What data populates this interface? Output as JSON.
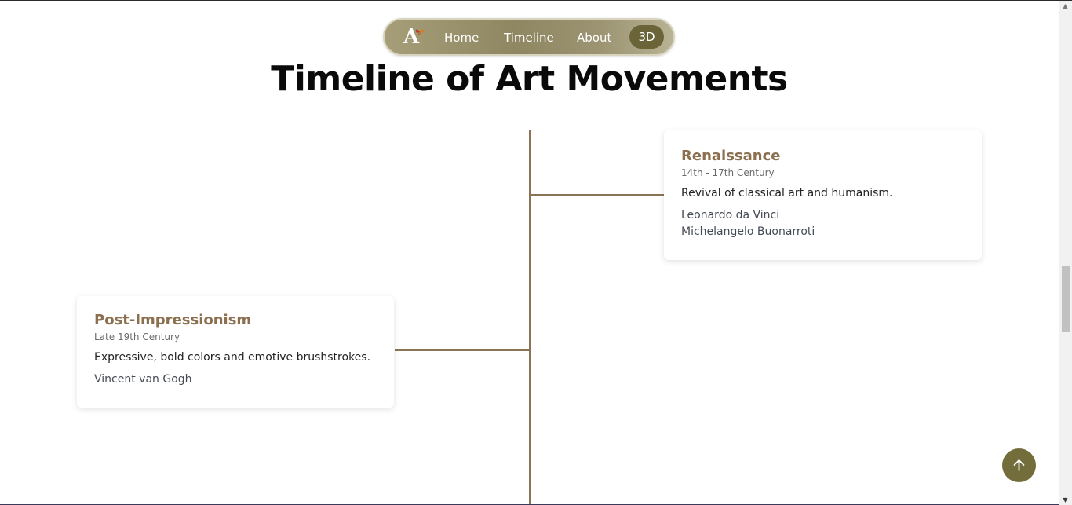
{
  "nav": {
    "logo_letter": "A",
    "logo_icon": "butterfly-icon",
    "items": [
      {
        "label": "Home"
      },
      {
        "label": "Timeline"
      },
      {
        "label": "About"
      }
    ],
    "active_label": "3D",
    "colors": {
      "pill_gradient_start": "#a59e78",
      "pill_gradient_end": "#b8b394",
      "active_bg": "#6b6438"
    }
  },
  "page": {
    "title": "Timeline of Art Movements"
  },
  "timeline": {
    "line_color": "#8b7355",
    "entries": [
      {
        "side": "right",
        "name": "Renaissance",
        "period": "14th - 17th Century",
        "description": "Revival of classical art and humanism.",
        "artists": [
          "Leonardo da Vinci",
          "Michelangelo Buonarroti"
        ]
      },
      {
        "side": "left",
        "name": "Post-Impressionism",
        "period": "Late 19th Century",
        "description": "Expressive, bold colors and emotive brushstrokes.",
        "artists": [
          "Vincent van Gogh"
        ]
      }
    ]
  },
  "back_to_top": {
    "icon": "arrow-up-icon",
    "color": "#736d3c"
  },
  "colors": {
    "movement_title": "#8b6f4e"
  }
}
